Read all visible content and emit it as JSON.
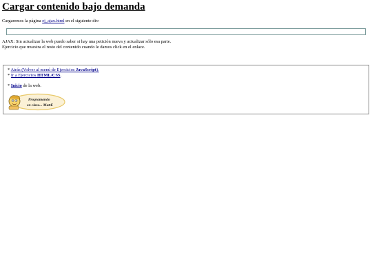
{
  "page": {
    "title": "Cargar contenido bajo demanda",
    "intro_before": "Cargaremos la página ",
    "intro_link": "ej_ajax.html",
    "intro_after": " en el siguiente div:",
    "ajax_note_1": "AJAX: Sin actualizar la web puedo saber si hay una petición nueva y actualizar sólo esa parte.",
    "ajax_note_2": "Ejercicio que muestra el resto del contenido cuando le damos click en el enlace."
  },
  "nav": {
    "bullet": "* ",
    "back_before": "Atrás (Volver al menú de Ejercicios ",
    "back_bold": "JavaScript",
    "back_after": ").",
    "exercises_before": "Ir a Ejercicios ",
    "exercises_bold": "HTML/CSS",
    "exercises_after": ".",
    "home_bold": "Inicio",
    "home_after": " de la web."
  },
  "logo": {
    "line1": "Programando",
    "line2": "en clase... MattE",
    "icon": "mascot-icon",
    "oval_color": "#e8c96a",
    "fill_color": "#fbf1d6"
  }
}
